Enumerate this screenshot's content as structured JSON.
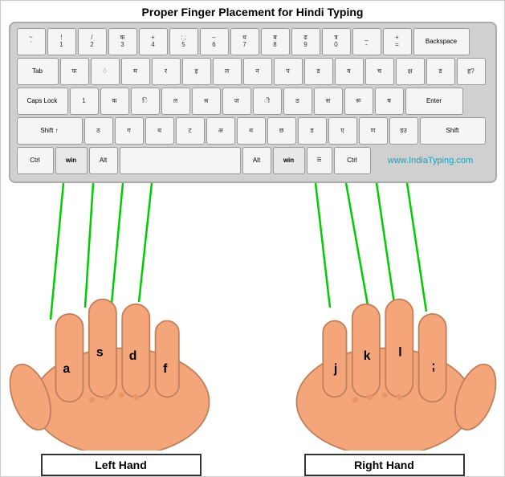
{
  "title": "Proper Finger Placement for Hindi Typing",
  "keyboard": {
    "rows": [
      {
        "keys": [
          {
            "label": "` ~",
            "hindi": ""
          },
          {
            "label": "1 !",
            "hindi": ""
          },
          {
            "label": "2 @",
            "hindi": "/"
          },
          {
            "label": "3 #",
            "hindi": "क"
          },
          {
            "label": "4 $",
            "hindi": "+"
          },
          {
            "label": "5 %",
            "hindi": ": ;"
          },
          {
            "label": "6 ^",
            "hindi": "–"
          },
          {
            "label": "7 &",
            "hindi": "ध"
          },
          {
            "label": "8 *",
            "hindi": "ब"
          },
          {
            "label": "9 (",
            "hindi": "ढ"
          },
          {
            "label": "0 )",
            "hindi": "त्र"
          },
          {
            "label": "- _",
            "hindi": ""
          },
          {
            "label": "= +",
            "hindi": ""
          },
          {
            "label": "Backspace",
            "hindi": "",
            "type": "backspace"
          }
        ]
      },
      {
        "keys": [
          {
            "label": "Tab",
            "hindi": "",
            "type": "tab"
          },
          {
            "label": "",
            "hindi": "फ"
          },
          {
            "label": "",
            "hindi": "ं"
          },
          {
            "label": "",
            "hindi": "म"
          },
          {
            "label": "",
            "hindi": "र"
          },
          {
            "label": "",
            "hindi": "इ"
          },
          {
            "label": "",
            "hindi": "ल"
          },
          {
            "label": "",
            "hindi": "न"
          },
          {
            "label": "",
            "hindi": "प"
          },
          {
            "label": "",
            "hindi": "ड"
          },
          {
            "label": "",
            "hindi": "व"
          },
          {
            "label": "",
            "hindi": "च"
          },
          {
            "label": "",
            "hindi": "क्ष"
          },
          {
            "label": "",
            "hindi": "ड"
          },
          {
            "label": "",
            "hindi": "ह?"
          }
        ]
      },
      {
        "keys": [
          {
            "label": "Caps Lock",
            "hindi": "",
            "type": "caps"
          },
          {
            "label": "1",
            "hindi": ""
          },
          {
            "label": "",
            "hindi": "क"
          },
          {
            "label": "",
            "hindi": "ि"
          },
          {
            "label": "",
            "hindi": "ल"
          },
          {
            "label": "",
            "hindi": "श्र"
          },
          {
            "label": "",
            "hindi": "ज"
          },
          {
            "label": "",
            "hindi": ""
          },
          {
            "label": "",
            "hindi": "ठ"
          },
          {
            "label": "",
            "hindi": "स"
          },
          {
            "label": "",
            "hindi": "रू"
          },
          {
            "label": "",
            "hindi": "ष"
          },
          {
            "label": "Enter",
            "hindi": "",
            "type": "enter"
          }
        ]
      },
      {
        "keys": [
          {
            "label": "Shift ↑",
            "hindi": "",
            "type": "shift-l"
          },
          {
            "label": "",
            "hindi": "ठ"
          },
          {
            "label": "",
            "hindi": "ग"
          },
          {
            "label": "",
            "hindi": "थ"
          },
          {
            "label": "",
            "hindi": "ट"
          },
          {
            "label": "",
            "hindi": "अ"
          },
          {
            "label": "",
            "hindi": "थ"
          },
          {
            "label": "",
            "hindi": "छ"
          },
          {
            "label": "",
            "hindi": "ड"
          },
          {
            "label": "",
            "hindi": "ए"
          },
          {
            "label": "",
            "hindi": "ण"
          },
          {
            "label": "",
            "hindi": "ड़ उ"
          },
          {
            "label": "Shift",
            "hindi": "",
            "type": "shift-r"
          }
        ]
      },
      {
        "keys": [
          {
            "label": "Ctrl",
            "hindi": "",
            "type": "ctrl"
          },
          {
            "label": "win",
            "hindi": "",
            "type": "win"
          },
          {
            "label": "Alt",
            "hindi": "",
            "type": "alt"
          },
          {
            "label": "",
            "hindi": "",
            "type": "space"
          },
          {
            "label": "Alt",
            "hindi": "",
            "type": "alt"
          },
          {
            "label": "win",
            "hindi": "",
            "type": "win"
          },
          {
            "label": "☰",
            "hindi": "",
            "type": "menu"
          },
          {
            "label": "Ctrl",
            "hindi": "",
            "type": "ctrl"
          }
        ]
      }
    ],
    "website": "www.IndiaTyping.com"
  },
  "hands": {
    "left": {
      "label": "Left Hand",
      "fingers": [
        "a",
        "s",
        "d",
        "f"
      ]
    },
    "right": {
      "label": "Right Hand",
      "fingers": [
        "j",
        "k",
        "l",
        ";"
      ]
    }
  }
}
